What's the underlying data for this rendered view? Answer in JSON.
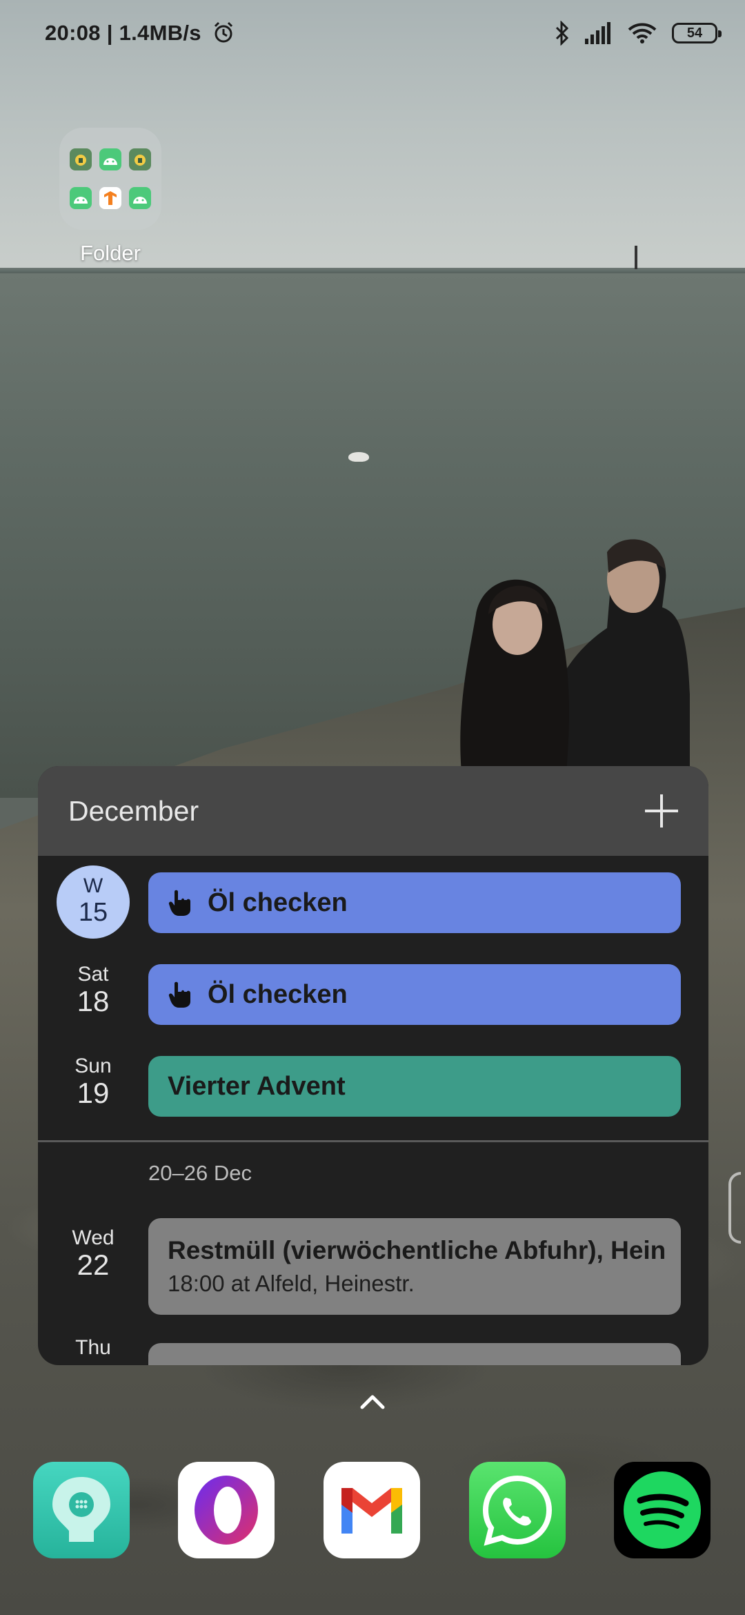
{
  "status_bar": {
    "left_text": "20:08 | 1.4MB/s",
    "battery": "54",
    "icons": [
      "alarm-icon",
      "bluetooth-icon",
      "signal-icon",
      "wifi-icon",
      "battery-icon"
    ]
  },
  "folder": {
    "label": "Folder",
    "apps": [
      "app-icon",
      "app-icon",
      "app-icon",
      "app-icon",
      "app-icon",
      "app-icon"
    ]
  },
  "calendar_widget": {
    "month": "December",
    "add_icon": "plus-icon",
    "days": [
      {
        "dow": "W",
        "num": "15",
        "is_today": true,
        "event": "Öl checken",
        "color": "#6884e1",
        "icon": "hand-icon"
      },
      {
        "dow": "Sat",
        "num": "18",
        "event": "Öl checken",
        "color": "#6884e1",
        "icon": "hand-icon"
      },
      {
        "dow": "Sun",
        "num": "19",
        "event": "Vierter Advent",
        "color": "#3d9c89"
      }
    ],
    "week_label": "20–26 Dec",
    "later": [
      {
        "dow": "Wed",
        "num": "22",
        "title": "Restmüll (vierwöchentliche Abfuhr), Hein",
        "detail": "18:00 at Alfeld, Heinestr.",
        "color": "#818181"
      },
      {
        "dow": "Thu"
      }
    ]
  },
  "dock": {
    "apps": [
      {
        "name": "wellbeing-app-icon",
        "color": "#3dc7b0"
      },
      {
        "name": "opera-app-icon",
        "color": "#ffffff"
      },
      {
        "name": "gmail-app-icon",
        "color": "#ffffff"
      },
      {
        "name": "whatsapp-app-icon",
        "color": "#25d366"
      },
      {
        "name": "spotify-app-icon",
        "color": "#1ed760"
      }
    ]
  }
}
